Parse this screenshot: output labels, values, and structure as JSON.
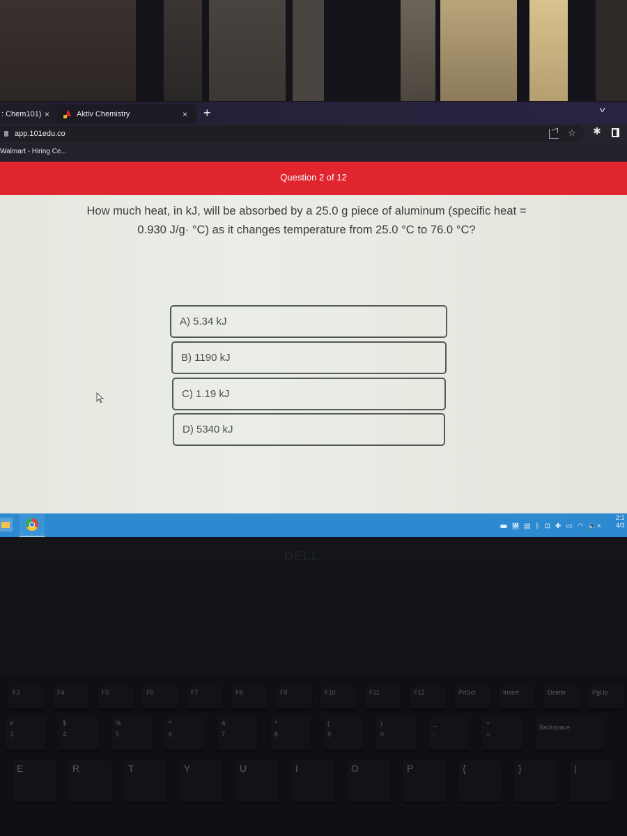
{
  "browser": {
    "tabs": [
      {
        "title": ": Chem101)",
        "active": false
      },
      {
        "title": "Aktiv Chemistry",
        "active": true
      }
    ],
    "close_glyph": "×",
    "new_tab_glyph": "+",
    "tab_list_glyph": "v",
    "url": "app.101edu.co",
    "bookmarks": [
      "Walmart - Hiring Ce..."
    ],
    "icons": {
      "lock": "lock-icon",
      "share": "share-icon",
      "bookmark_star": "☆",
      "extensions": "✱",
      "side_panel": "side-panel-icon"
    }
  },
  "quiz": {
    "progress_label": "Question 2 of 12",
    "current_question": 2,
    "total_questions": 12,
    "question_text": "How much heat, in kJ, will be absorbed by a 25.0 g piece of aluminum (specific heat = 0.930 J/g· °C) as it changes temperature from 25.0 °C to 76.0 °C?",
    "options": [
      {
        "letter": "A",
        "label": "A) 5.34 kJ"
      },
      {
        "letter": "B",
        "label": "B) 1190 kJ"
      },
      {
        "letter": "C",
        "label": "C) 1.19 kJ"
      },
      {
        "letter": "D",
        "label": "D) 5340 kJ"
      }
    ],
    "accent_color": "#e0252f"
  },
  "taskbar": {
    "pinned": [
      "file-explorer",
      "chrome"
    ],
    "tray_icons": [
      "onedrive",
      "word",
      "monitor",
      "bluetooth",
      "meet-now",
      "security",
      "battery",
      "wifi",
      "volume-muted"
    ],
    "word_glyph": "W",
    "bluetooth_glyph": "ᛒ",
    "wifi_glyph": "◠",
    "volume_glyph": "🔈×",
    "clock_time": "2:1",
    "clock_date": "4/3",
    "color": "#2e8ad0"
  },
  "laptop": {
    "brand": "DELL",
    "keys_row_f": [
      "F3",
      "F4",
      "F5",
      "F6",
      "F7",
      "F8",
      "F9",
      "F10",
      "F11",
      "F12",
      "PrtScr",
      "Insert",
      "Delete",
      "PgUp"
    ],
    "keys_row_num": [
      {
        "top": "#",
        "bot": "3"
      },
      {
        "top": "$",
        "bot": "4"
      },
      {
        "top": "%",
        "bot": "5"
      },
      {
        "top": "^",
        "bot": "6"
      },
      {
        "top": "&",
        "bot": "7"
      },
      {
        "top": "*",
        "bot": "8"
      },
      {
        "top": "(",
        "bot": "9"
      },
      {
        "top": ")",
        "bot": "0"
      },
      {
        "top": "_",
        "bot": "-"
      },
      {
        "top": "+",
        "bot": "="
      },
      {
        "top": "",
        "bot": "Backspace"
      }
    ],
    "keys_row_alpha": [
      "E",
      "R",
      "T",
      "Y",
      "U",
      "I",
      "O",
      "P",
      "{",
      "}",
      "|"
    ]
  }
}
